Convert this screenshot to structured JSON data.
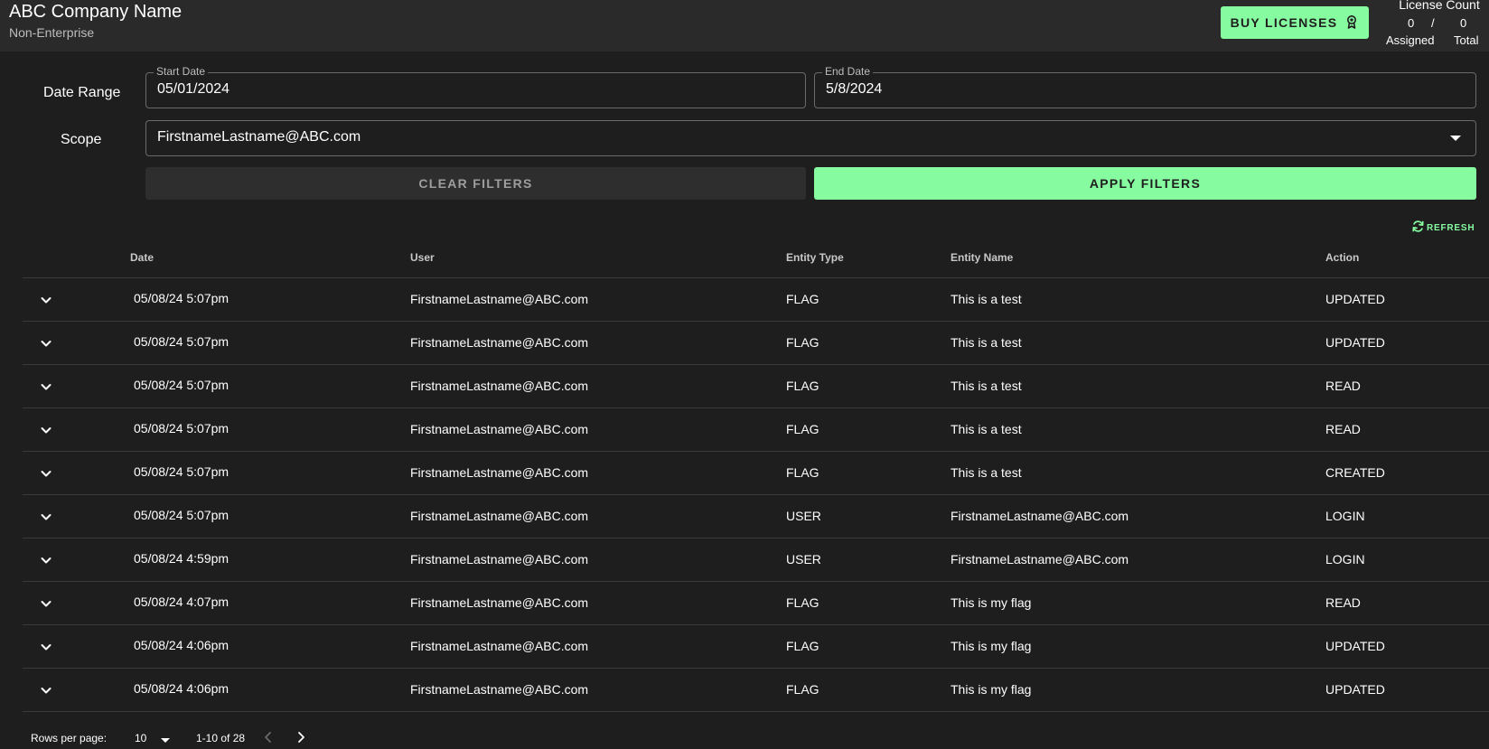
{
  "header": {
    "company": "ABC Company Name",
    "tier": "Non-Enterprise",
    "buy_label": "BUY LICENSES",
    "license": {
      "title": "License Count",
      "assigned": "0",
      "separator": "/",
      "total": "0",
      "assigned_label": "Assigned",
      "total_label": "Total"
    }
  },
  "filters": {
    "date_range_label": "Date Range",
    "start_label": "Start Date",
    "start_value": "05/01/2024",
    "end_label": "End Date",
    "end_value": "5/8/2024",
    "scope_label": "Scope",
    "scope_value": "FirstnameLastname@ABC.com",
    "clear_label": "CLEAR FILTERS",
    "apply_label": "APPLY FILTERS",
    "refresh_label": "REFRESH"
  },
  "table": {
    "headers": [
      "Date",
      "User",
      "Entity Type",
      "Entity Name",
      "Action"
    ],
    "rows": [
      [
        "05/08/24 5:07pm",
        "FirstnameLastname@ABC.com",
        "FLAG",
        "This is a test",
        "UPDATED"
      ],
      [
        "05/08/24 5:07pm",
        "FirstnameLastname@ABC.com",
        "FLAG",
        "This is a test",
        "UPDATED"
      ],
      [
        "05/08/24 5:07pm",
        "FirstnameLastname@ABC.com",
        "FLAG",
        "This is a test",
        "READ"
      ],
      [
        "05/08/24 5:07pm",
        "FirstnameLastname@ABC.com",
        "FLAG",
        "This is a test",
        "READ"
      ],
      [
        "05/08/24 5:07pm",
        "FirstnameLastname@ABC.com",
        "FLAG",
        "This is a test",
        "CREATED"
      ],
      [
        "05/08/24 5:07pm",
        "FirstnameLastname@ABC.com",
        "USER",
        "FirstnameLastname@ABC.com",
        "LOGIN"
      ],
      [
        "05/08/24 4:59pm",
        "FirstnameLastname@ABC.com",
        "USER",
        "FirstnameLastname@ABC.com",
        "LOGIN"
      ],
      [
        "05/08/24 4:07pm",
        "FirstnameLastname@ABC.com",
        "FLAG",
        "This is my flag",
        "READ"
      ],
      [
        "05/08/24 4:06pm",
        "FirstnameLastname@ABC.com",
        "FLAG",
        "This is my flag",
        "UPDATED"
      ],
      [
        "05/08/24 4:06pm",
        "FirstnameLastname@ABC.com",
        "FLAG",
        "This is my flag",
        "UPDATED"
      ]
    ]
  },
  "pagination": {
    "rows_per_page_label": "Rows per page:",
    "rows_per_page": "10",
    "range": "1-10 of 28"
  },
  "colors": {
    "accent": "#86fba0",
    "background": "#1e1e1e",
    "topbar": "#2a2a2a"
  }
}
